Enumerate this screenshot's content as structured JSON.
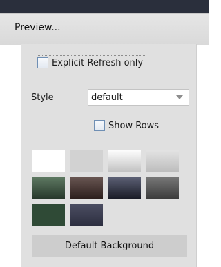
{
  "header": {
    "title": "Preview..."
  },
  "explicit_refresh": {
    "label": "Explicit Refresh only",
    "checked": false
  },
  "style": {
    "label": "Style",
    "value": "default"
  },
  "show_rows": {
    "label": "Show Rows",
    "checked": false
  },
  "swatches": [
    {
      "name": "white",
      "bg": "#ffffff"
    },
    {
      "name": "light-gray",
      "bg": "#d2d2d2"
    },
    {
      "name": "white-gray-gradient",
      "bg": "linear-gradient(#ffffff, #c2c2c2)"
    },
    {
      "name": "light-gray-gradient",
      "bg": "linear-gradient(#e4e4e4, #bdbdbd)"
    },
    {
      "name": "dark-green-gradient",
      "bg": "linear-gradient(#5f7a63, #27382b)"
    },
    {
      "name": "dark-brown-gradient",
      "bg": "linear-gradient(#6a5753, #2b1e1c)"
    },
    {
      "name": "dark-blue-gradient",
      "bg": "linear-gradient(#5d6176, #1a1c27)"
    },
    {
      "name": "dark-gray-gradient",
      "bg": "linear-gradient(#787878, #3c3c3c)"
    },
    {
      "name": "dark-green",
      "bg": "#2f4a36"
    },
    {
      "name": "dark-slate",
      "bg": "linear-gradient(#4c4f63, #2d2f40)"
    }
  ],
  "default_background_button": {
    "label": "Default Background"
  }
}
